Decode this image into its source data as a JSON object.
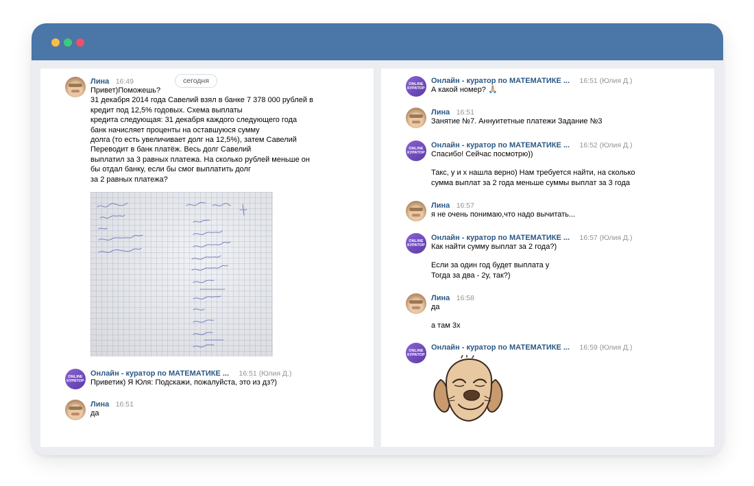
{
  "left_panel": {
    "date_label": "сегодня",
    "messages": [
      {
        "author": "Лина",
        "time": "16:49",
        "paragraphs": [
          "Привет)Поможешь?\n31 декабря 2014 года Савелий взял в банке 7 378 000 рублей в\nкредит под 12,5% годовых. Схема выплаты\nкредита следующая: 31 декабря каждого следующего года\nбанк начисляет проценты на оставшуюся сумму\nдолга (то есть увеличивает долг на 12,5%), затем Савелий\nПереводит в банк платёж. Весь долг Савелий\nвыплатил за 3 равных платежа. На сколько рублей меньше он\nбы отдал банку, если бы смог выплатить долг\nза 2 равных платежа?"
        ]
      },
      {
        "author": "Онлайн - куратор по МАТЕМАТИКЕ ...",
        "time": "16:51 (Юлия Д.)",
        "paragraphs": [
          "Приветик) Я Юля: Подскажи, пожалуйста, это из дз?)"
        ]
      },
      {
        "author": "Лина",
        "time": "16:51",
        "paragraphs": [
          "да"
        ]
      }
    ]
  },
  "right_panel": {
    "messages": [
      {
        "author": "Онлайн - куратор по МАТЕМАТИКЕ ...",
        "time": "16:51 (Юлия Д.)",
        "paragraphs": [
          "А какой номер? 🙏🏼"
        ]
      },
      {
        "author": "Лина",
        "time": "16:51",
        "paragraphs": [
          "Занятие №7. Аннуитетные платежи Задание №3"
        ]
      },
      {
        "author": "Онлайн - куратор по МАТЕМАТИКЕ ...",
        "time": "16:52 (Юлия Д.)",
        "paragraphs": [
          "Спасибо! Сейчас посмотрю))",
          "Такс, у и х нашла верно) Нам требуется найти, на сколько\nсумма выплат за 2 года меньше суммы выплат за 3 года"
        ]
      },
      {
        "author": "Лина",
        "time": "16:57",
        "paragraphs": [
          "я не очень понимаю,что надо вычитать..."
        ]
      },
      {
        "author": "Онлайн - куратор по МАТЕМАТИКЕ ...",
        "time": "16:57 (Юлия Д.)",
        "paragraphs": [
          "Как найти сумму выплат за 2 года?)",
          "Если за один год будет выплата у\nТогда за два - 2у, так?)"
        ]
      },
      {
        "author": "Лина",
        "time": "16:58",
        "paragraphs": [
          "да",
          "а там 3х"
        ]
      },
      {
        "author": "Онлайн - куратор по МАТЕМАТИКЕ ...",
        "time": "16:59 (Юлия Д.)",
        "paragraphs": []
      }
    ]
  },
  "avatar_text": {
    "line1": "ONLINE",
    "line2": "КУРАТОР"
  },
  "icons": {
    "curator_avatar": "curator-avatar-icon",
    "user_avatar": "user-avatar-icon",
    "sticker": "laughing-dog-sticker-icon",
    "photo": "handwritten-math-photo"
  },
  "colors": {
    "titlebar": "#4a76a8",
    "author": "#2a5885",
    "time": "#939393",
    "dot_yellow": "#f7be47",
    "dot_green": "#3fc97a",
    "dot_red": "#f0506a"
  }
}
